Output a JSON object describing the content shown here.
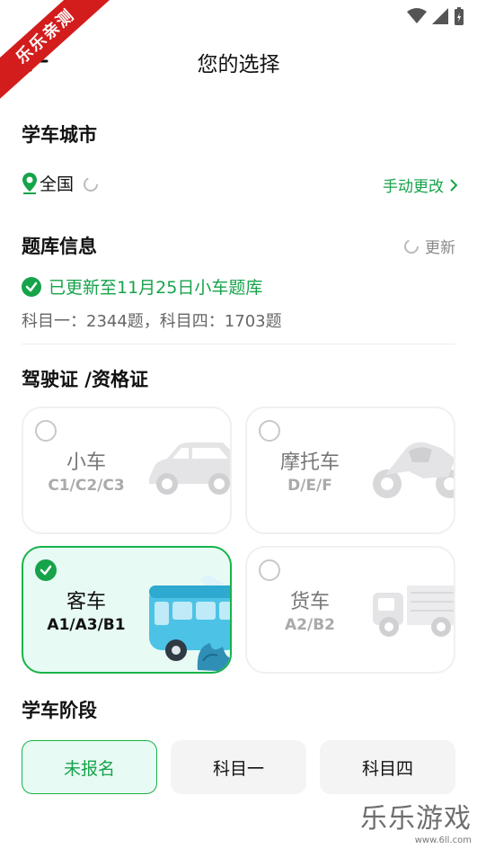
{
  "watermark": {
    "label": "乐乐亲测"
  },
  "header": {
    "title": "您的选择"
  },
  "city": {
    "section_title": "学车城市",
    "location": "全国",
    "manual_change": "手动更改"
  },
  "bank": {
    "section_title": "题库信息",
    "update_label": "更新",
    "updated_text": "已更新至11月25日小车题库",
    "counts_text": "科目一：2344题，科目四：1703题"
  },
  "license": {
    "section_title": "驾驶证 /资格证",
    "cards": [
      {
        "name": "小车",
        "codes": "C1/C2/C3",
        "icon": "car-icon",
        "selected": false
      },
      {
        "name": "摩托车",
        "codes": "D/E/F",
        "icon": "motorcycle-icon",
        "selected": false
      },
      {
        "name": "客车",
        "codes": "A1/A3/B1",
        "icon": "bus-icon",
        "selected": true
      },
      {
        "name": "货车",
        "codes": "A2/B2",
        "icon": "truck-icon",
        "selected": false
      }
    ]
  },
  "stage": {
    "section_title": "学车阶段",
    "options": [
      "未报名",
      "科目一",
      "科目四"
    ],
    "selected": "未报名"
  },
  "brand": {
    "name": "乐乐游戏",
    "url": "www.6ll.com"
  },
  "colors": {
    "accent": "#16a34a",
    "accent_bg": "#e8faf4",
    "ribbon": "#d31c1c"
  }
}
